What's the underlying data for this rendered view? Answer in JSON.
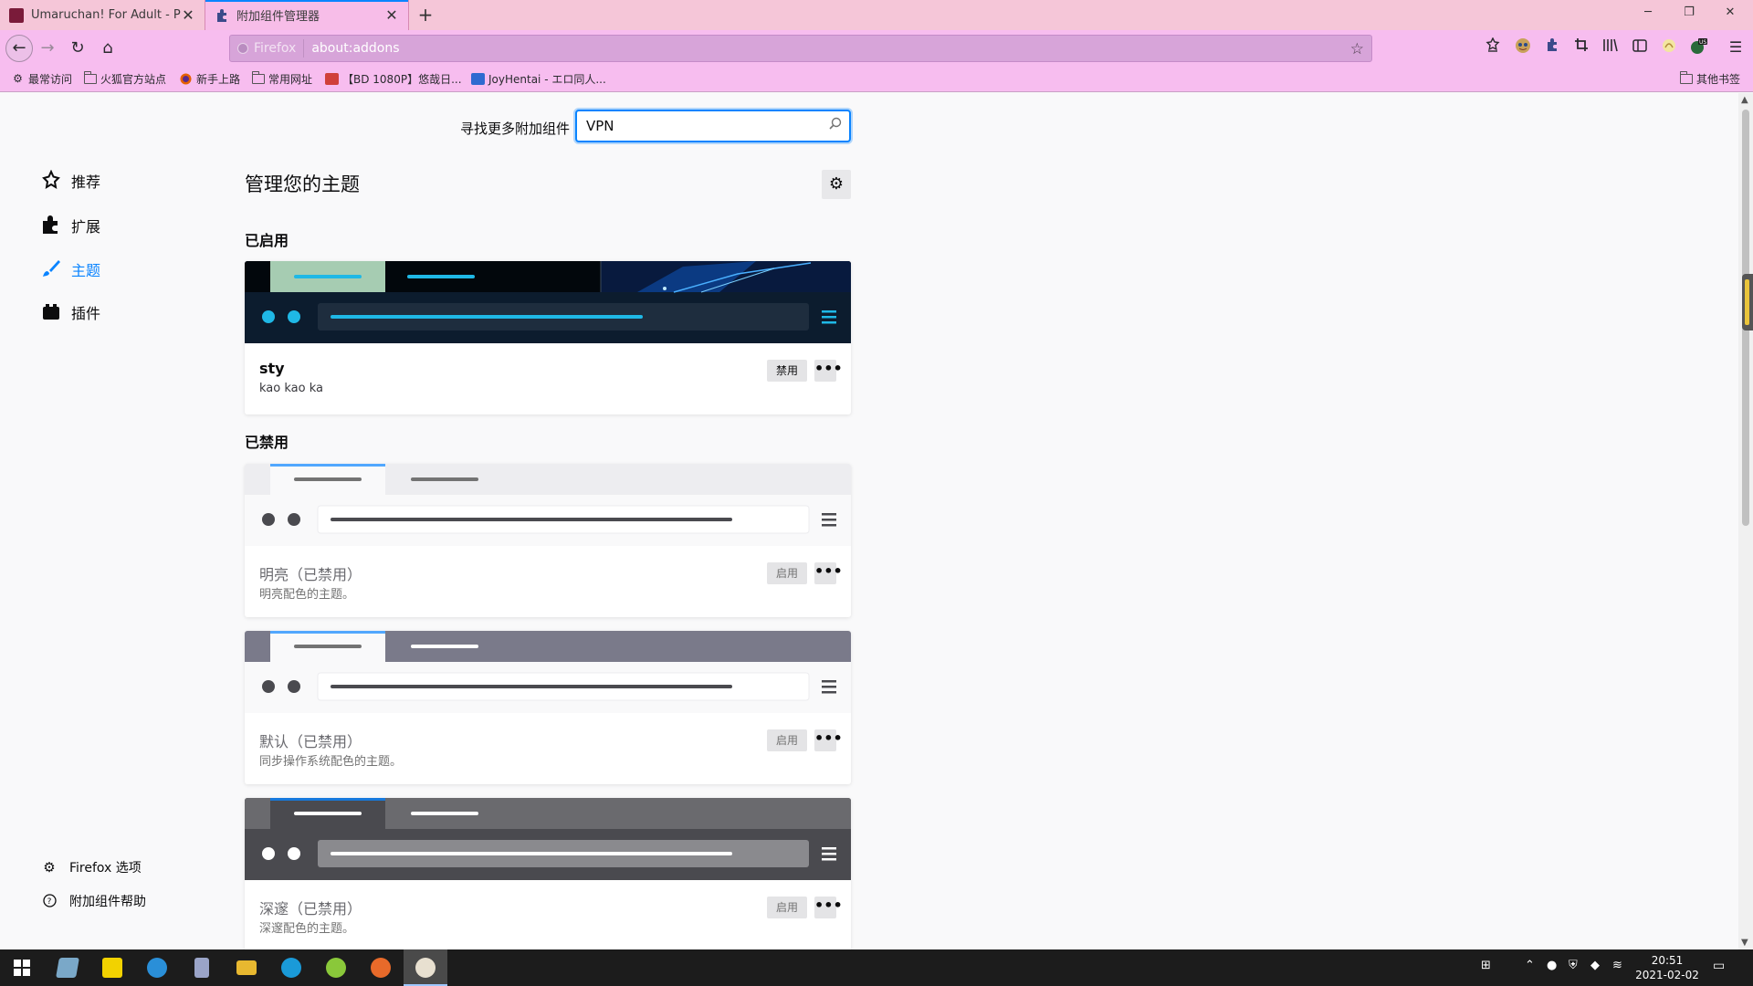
{
  "tabs": [
    {
      "title": "Umaruchan! For Adult - Pag",
      "close": "✕"
    },
    {
      "title": "附加组件管理器",
      "close": "✕"
    }
  ],
  "new_tab_symbol": "+",
  "window_controls": {
    "minimize": "─",
    "maximize": "❐",
    "close": "✕"
  },
  "navbar": {
    "back": "←",
    "forward": "→",
    "reload": "↻",
    "home": "⌂",
    "identity_label": "Firefox",
    "url": "about:addons",
    "star": "☆"
  },
  "toolbar_icons": [
    "reading-list-icon",
    "avatar-icon",
    "extensions-icon",
    "crop-icon",
    "library-icon",
    "sidebar-icon",
    "addon-icon",
    "vpn-icon",
    "menu-icon"
  ],
  "bookmarks": [
    {
      "label": "最常访问",
      "icon": "gear-icon"
    },
    {
      "label": "火狐官方站点",
      "icon": "folder-icon"
    },
    {
      "label": "新手上路",
      "icon": "firefox-icon"
    },
    {
      "label": "常用网址",
      "icon": "folder-icon"
    },
    {
      "label": "【BD 1080P】悠哉日...",
      "icon": "site-icon"
    },
    {
      "label": "JoyHentai - エロ同人...",
      "icon": "site-icon"
    }
  ],
  "other_bookmarks": "其他书签",
  "search": {
    "label": "寻找更多附加组件",
    "value": "VPN"
  },
  "categories": [
    {
      "label": "推荐",
      "icon": "recommended-icon"
    },
    {
      "label": "扩展",
      "icon": "puzzle-icon"
    },
    {
      "label": "主题",
      "icon": "brush-icon"
    },
    {
      "label": "插件",
      "icon": "plugin-icon"
    }
  ],
  "page_title": "管理您的主题",
  "sections": {
    "enabled": "已启用",
    "disabled": "已禁用"
  },
  "themes": [
    {
      "name": "sty",
      "description": "kao kao ka",
      "button": "禁用"
    },
    {
      "name": "明亮（已禁用）",
      "description": "明亮配色的主题。",
      "button": "启用"
    },
    {
      "name": "默认（已禁用）",
      "description": "同步操作系统配色的主题。",
      "button": "启用"
    },
    {
      "name": "深邃（已禁用）",
      "description": "深邃配色的主题。",
      "button": "启用"
    }
  ],
  "more_symbol": "•••",
  "footer": {
    "options": "Firefox 选项",
    "help": "附加组件帮助"
  },
  "taskbar": {
    "time": "20:51",
    "date": "2021-02-02",
    "apps": [
      "start-button",
      "notes-app",
      "sticky-notes-app",
      "feather-app",
      "archive-app",
      "file-explorer-app",
      "edge-app",
      "app-green",
      "firefox-app",
      "active-app"
    ]
  },
  "colors": {
    "accent": "#0a84ff",
    "tab_bar": "#f5c6d8",
    "toolbar": "#f7bdef",
    "sty_header": "#0c1c2e",
    "sty_accent": "#1fb8e6",
    "light_header": "#ededf0",
    "default_header": "#7a7a8a",
    "dark_header": "#6a6a6e"
  }
}
